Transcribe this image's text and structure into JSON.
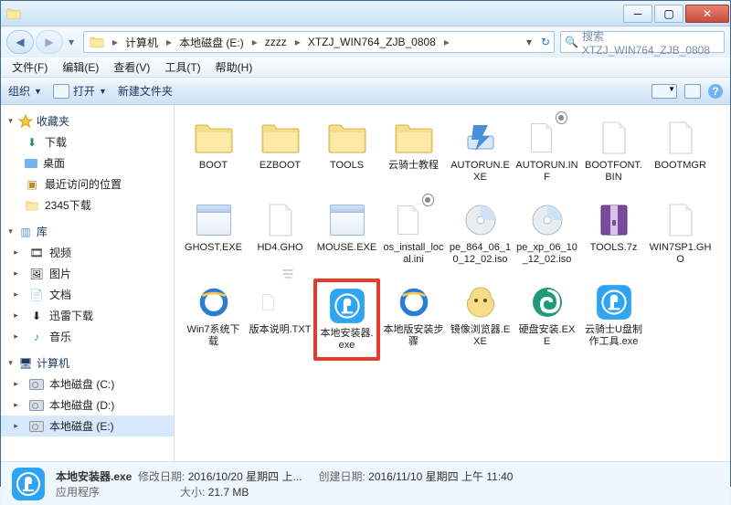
{
  "window": {
    "title": ""
  },
  "nav": {
    "crumbs": [
      "计算机",
      "本地磁盘 (E:)",
      "zzzz",
      "XTZJ_WIN764_ZJB_0808"
    ],
    "search_placeholder": "搜索 XTZJ_WIN764_ZJB_0808"
  },
  "menu": [
    "文件(F)",
    "编辑(E)",
    "查看(V)",
    "工具(T)",
    "帮助(H)"
  ],
  "toolbar": {
    "organize": "组织",
    "open": "打开",
    "newfolder": "新建文件夹"
  },
  "sidebar": {
    "favorites": {
      "label": "收藏夹",
      "items": [
        "下载",
        "桌面",
        "最近访问的位置",
        "2345下载"
      ]
    },
    "libraries": {
      "label": "库",
      "items": [
        "视频",
        "图片",
        "文档",
        "迅雷下载",
        "音乐"
      ]
    },
    "computer": {
      "label": "计算机",
      "items": [
        "本地磁盘 (C:)",
        "本地磁盘 (D:)",
        "本地磁盘 (E:)"
      ]
    }
  },
  "files": [
    {
      "name": "BOOT",
      "type": "folder"
    },
    {
      "name": "EZBOOT",
      "type": "folder"
    },
    {
      "name": "TOOLS",
      "type": "folder"
    },
    {
      "name": "云骑士教程",
      "type": "folder"
    },
    {
      "name": "AUTORUN.EXE",
      "type": "exe-run"
    },
    {
      "name": "AUTORUN.INF",
      "type": "ini"
    },
    {
      "name": "BOOTFONT.BIN",
      "type": "blank"
    },
    {
      "name": "BOOTMGR",
      "type": "blank"
    },
    {
      "name": "GHOST.EXE",
      "type": "app"
    },
    {
      "name": "HD4.GHO",
      "type": "gho"
    },
    {
      "name": "MOUSE.EXE",
      "type": "app"
    },
    {
      "name": "os_install_local.ini",
      "type": "ini"
    },
    {
      "name": "pe_864_06_10_12_02.iso",
      "type": "iso"
    },
    {
      "name": "pe_xp_06_10_12_02.iso",
      "type": "iso"
    },
    {
      "name": "TOOLS.7z",
      "type": "archive"
    },
    {
      "name": "WIN7SP1.GHO",
      "type": "gho"
    },
    {
      "name": "Win7系统下载",
      "type": "ie"
    },
    {
      "name": "版本说明.TXT",
      "type": "txt"
    },
    {
      "name": "本地安装器.exe",
      "type": "yunqishi",
      "highlight": true
    },
    {
      "name": "本地版安装步骤",
      "type": "ie"
    },
    {
      "name": "镜像浏览器.EXE",
      "type": "viewer"
    },
    {
      "name": "硬盘安装.EXE",
      "type": "swirl"
    },
    {
      "name": "云骑士U盘制作工具.exe",
      "type": "yunqishi"
    }
  ],
  "status": {
    "name": "本地安装器.exe",
    "type": "应用程序",
    "mod_label": "修改日期:",
    "mod_value": "2016/10/20 星期四 上...",
    "create_label": "创建日期:",
    "create_value": "2016/11/10 星期四 上午 11:40",
    "size_label": "大小:",
    "size_value": "21.7 MB"
  }
}
